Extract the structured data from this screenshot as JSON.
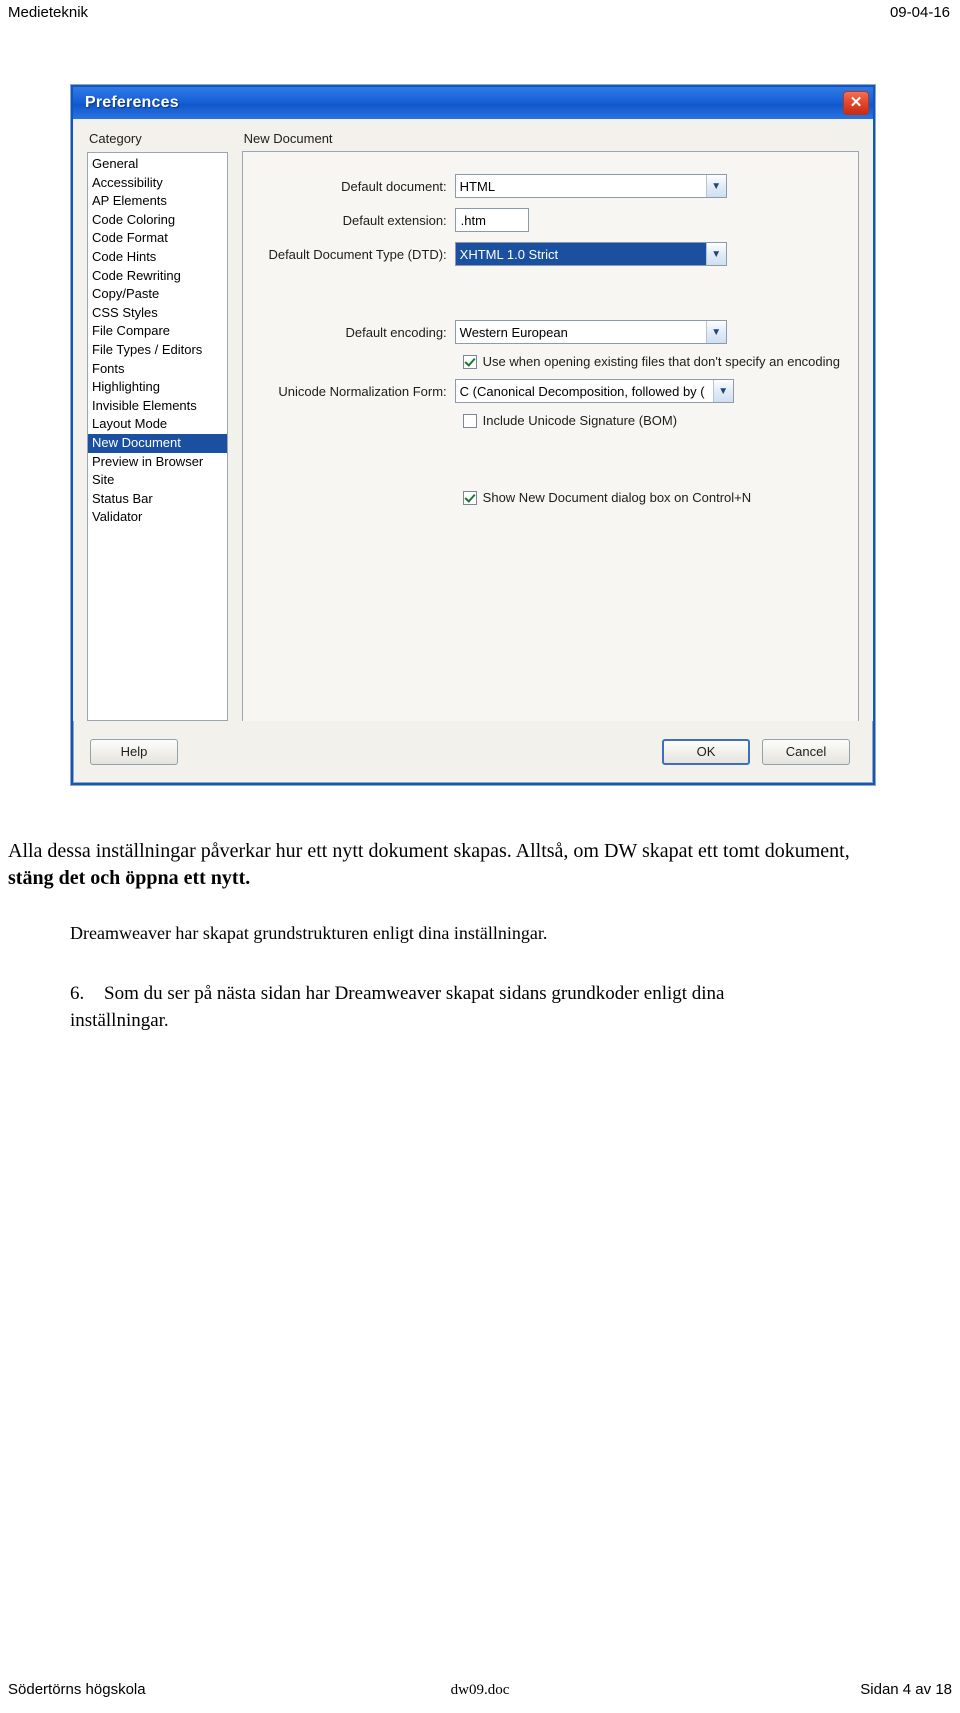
{
  "page_header": {
    "left": "Medieteknik",
    "right": "09-04-16"
  },
  "dialog": {
    "title": "Preferences",
    "close_icon": "close-icon",
    "category_heading": "Category",
    "categories": [
      "General",
      "Accessibility",
      "AP Elements",
      "Code Coloring",
      "Code Format",
      "Code Hints",
      "Code Rewriting",
      "Copy/Paste",
      "CSS Styles",
      "File Compare",
      "File Types / Editors",
      "Fonts",
      "Highlighting",
      "Invisible Elements",
      "Layout Mode",
      "New Document",
      "Preview in Browser",
      "Site",
      "Status Bar",
      "Validator"
    ],
    "selected_category": "New Document",
    "panel_title": "New Document",
    "fields": {
      "default_document_label": "Default document:",
      "default_document_value": "HTML",
      "default_extension_label": "Default extension:",
      "default_extension_value": ".htm",
      "dtd_label": "Default Document Type (DTD):",
      "dtd_value": "XHTML 1.0 Strict",
      "encoding_label": "Default encoding:",
      "encoding_value": "Western European",
      "use_when_opening_label": "Use when opening existing files that don't specify an encoding",
      "use_when_opening_checked": true,
      "unicode_norm_label": "Unicode Normalization Form:",
      "unicode_norm_value": "C (Canonical Decomposition, followed by (",
      "include_bom_label": "Include Unicode Signature (BOM)",
      "include_bom_checked": false,
      "show_new_doc_label": "Show New Document dialog box on Control+N",
      "show_new_doc_checked": true
    },
    "buttons": {
      "help": "Help",
      "ok": "OK",
      "cancel": "Cancel"
    },
    "colors": {
      "titlebar_blue": "#1761d8",
      "selection_blue": "#1b4fa0",
      "close_red": "#c62d16",
      "check_green": "#1d7a34"
    }
  },
  "body_text": {
    "paragraph_1_part1": "Alla dessa inställningar påverkar hur ett nytt dokument skapas. Alltså, om DW skapat ett tomt dokument, ",
    "paragraph_1_bold": "stäng det och öppna ett nytt.",
    "paragraph_2": "Dreamweaver har skapat grundstrukturen enligt dina inställningar.",
    "list_number": "6.",
    "list_text": "Som du ser på nästa sidan har Dreamweaver skapat sidans grundkoder enligt dina",
    "list_text_line2": "inställningar."
  },
  "page_footer": {
    "left": "Södertörns högskola",
    "middle": "dw09.doc",
    "right": "Sidan 4 av 18"
  }
}
